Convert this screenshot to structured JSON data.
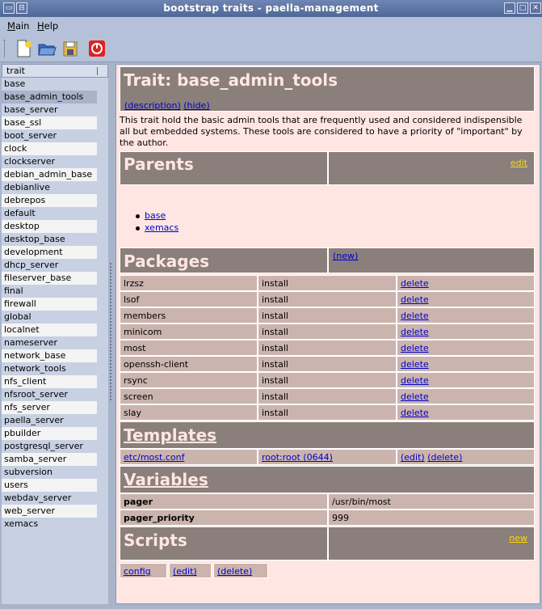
{
  "window": {
    "title": "bootstrap traits - paella-management"
  },
  "menu": {
    "main": "Main",
    "main_accel": "M",
    "help": "Help",
    "help_accel": "H"
  },
  "toolbar": [
    "new-document-icon",
    "open-folder-icon",
    "save-icon",
    "quit-icon"
  ],
  "sidebar": {
    "header": "trait",
    "selected": "base_admin_tools",
    "items": [
      "base",
      "base_admin_tools",
      "base_server",
      "base_ssl",
      "boot_server",
      "clock",
      "clockserver",
      "debian_admin_base",
      "debianlive",
      "debrepos",
      "default",
      "desktop",
      "desktop_base",
      "development",
      "dhcp_server",
      "fileserver_base",
      "final",
      "firewall",
      "global",
      "localnet",
      "nameserver",
      "network_base",
      "network_tools",
      "nfs_client",
      "nfsroot_server",
      "nfs_server",
      "paella_server",
      "pbuilder",
      "postgresql_server",
      "samba_server",
      "subversion",
      "users",
      "webdav_server",
      "web_server",
      "xemacs"
    ]
  },
  "trait": {
    "title": "Trait: base_admin_tools",
    "description_link": "(description)",
    "hide_link": "(hide)",
    "description": "This trait hold the basic admin tools that are frequently used and considered indispensible all but embedded systems. These tools are considered to have a priority of \"important\" by the author."
  },
  "parents": {
    "heading": "Parents",
    "edit": "edit",
    "items": [
      "base",
      "xemacs"
    ]
  },
  "packages": {
    "heading": "Packages",
    "new": "(new)",
    "rows": [
      {
        "name": "lrzsz",
        "action": "install",
        "op": "delete"
      },
      {
        "name": "lsof",
        "action": "install",
        "op": "delete"
      },
      {
        "name": "members",
        "action": "install",
        "op": "delete"
      },
      {
        "name": "minicom",
        "action": "install",
        "op": "delete"
      },
      {
        "name": "most",
        "action": "install",
        "op": "delete"
      },
      {
        "name": "openssh-client",
        "action": "install",
        "op": "delete"
      },
      {
        "name": "rsync",
        "action": "install",
        "op": "delete"
      },
      {
        "name": "screen",
        "action": "install",
        "op": "delete"
      },
      {
        "name": "slay",
        "action": "install",
        "op": "delete"
      }
    ]
  },
  "templates": {
    "heading": "Templates",
    "row": {
      "path": "etc/most.conf",
      "owner": "root:root (0644)",
      "edit": "(edit)",
      "delete": "(delete)"
    }
  },
  "variables": {
    "heading": "Variables",
    "rows": [
      {
        "name": "pager",
        "value": "/usr/bin/most"
      },
      {
        "name": "pager_priority",
        "value": "999"
      }
    ]
  },
  "scripts": {
    "heading": "Scripts",
    "new": "new",
    "row": {
      "name": "config",
      "edit": "(edit)",
      "delete": "(delete)"
    }
  }
}
